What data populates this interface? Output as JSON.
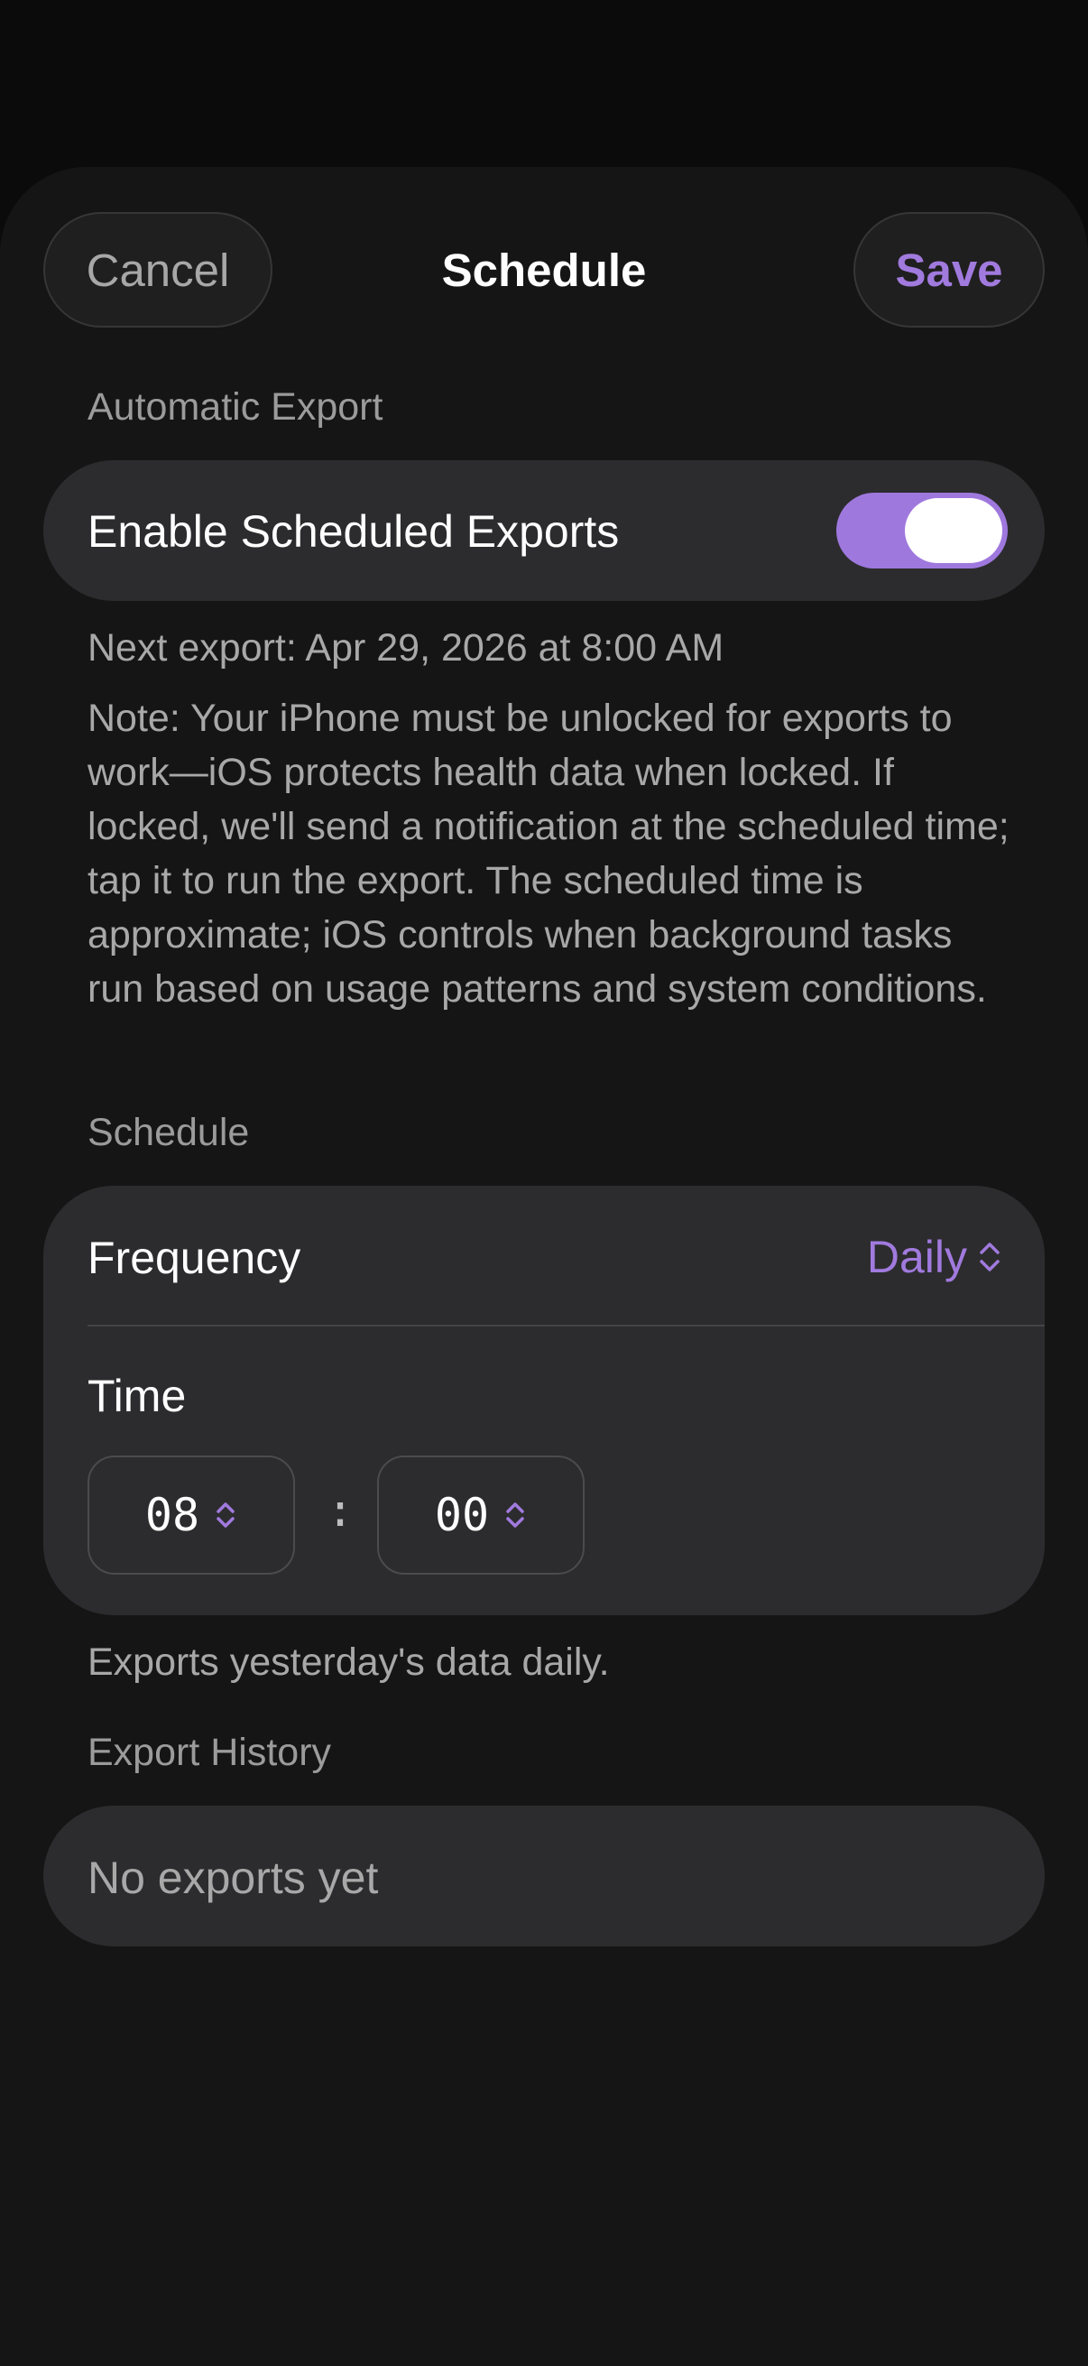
{
  "header": {
    "cancel_label": "Cancel",
    "title": "Schedule",
    "save_label": "Save"
  },
  "automatic_export": {
    "section_label": "Automatic Export",
    "toggle_label": "Enable Scheduled Exports",
    "toggle_on": true,
    "next_export": "Next export: Apr 29, 2026 at 8:00 AM",
    "note": "Note: Your iPhone must be unlocked for exports to work—iOS protects health data when locked. If locked, we'll send a notification at the scheduled time; tap it to run the export. The scheduled time is approximate; iOS controls when background tasks run based on usage patterns and system conditions."
  },
  "schedule": {
    "section_label": "Schedule",
    "frequency_label": "Frequency",
    "frequency_value": "Daily",
    "time_label": "Time",
    "hour": "08",
    "minute": "00",
    "separator": ":",
    "footer": "Exports yesterday's data daily."
  },
  "history": {
    "section_label": "Export History",
    "empty_text": "No exports yet"
  },
  "colors": {
    "accent": "#9f78de",
    "background": "#151515",
    "card": "#2c2c2e",
    "secondary_text": "#a8a8a8"
  },
  "icons": {
    "frequency_picker": "chevron-up-down-icon",
    "hour_stepper": "chevron-up-down-icon",
    "minute_stepper": "chevron-up-down-icon"
  }
}
